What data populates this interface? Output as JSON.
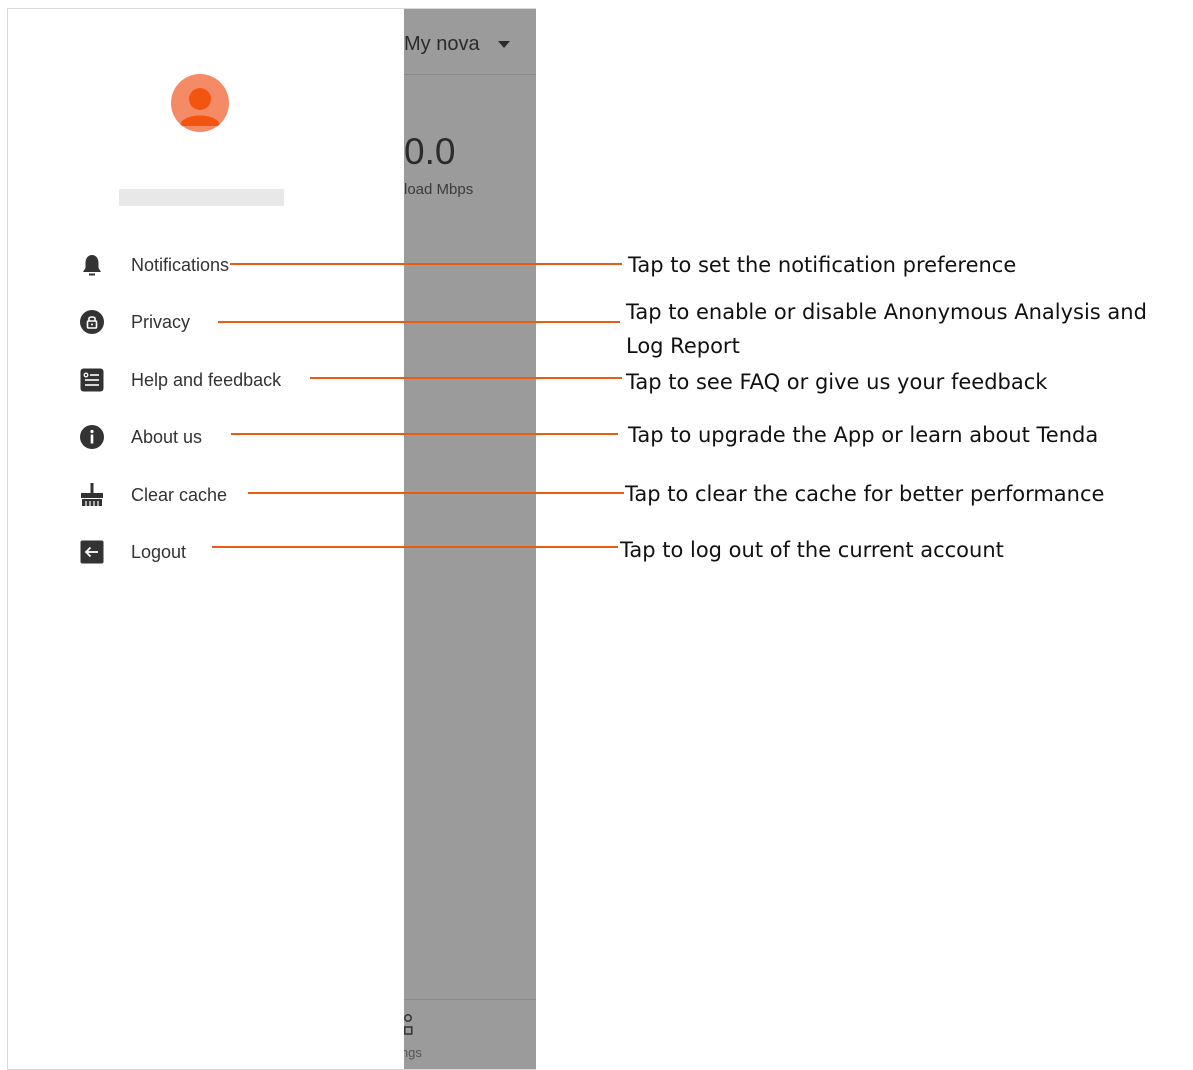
{
  "backdrop": {
    "title": "My nova",
    "speed_value": "0.0",
    "speed_unit": "load Mbps",
    "nav_label": "ings"
  },
  "drawer": {
    "avatar_icon": "user-avatar-icon",
    "menu": [
      {
        "label": "Notifications",
        "icon": "bell-icon"
      },
      {
        "label": "Privacy",
        "icon": "lock-icon"
      },
      {
        "label": "Help and feedback",
        "icon": "list-doc-icon"
      },
      {
        "label": "About us",
        "icon": "info-icon"
      },
      {
        "label": "Clear cache",
        "icon": "broom-icon"
      },
      {
        "label": "Logout",
        "icon": "logout-icon"
      }
    ]
  },
  "callouts": [
    {
      "text": "Tap to set the notification preference"
    },
    {
      "text": "Tap to enable or disable Anonymous Analysis and",
      "text_line2": "Log Report"
    },
    {
      "text": "Tap to see FAQ or give us your feedback"
    },
    {
      "text": "Tap to upgrade the App or learn about Tenda"
    },
    {
      "text": "Tap to clear the cache for better performance"
    },
    {
      "text": "Tap to log out of the current account"
    }
  ],
  "colors": {
    "accent": "#e85d14",
    "avatar": "#f58a66",
    "overlay": "#9b9b9b",
    "icon": "#333333"
  }
}
